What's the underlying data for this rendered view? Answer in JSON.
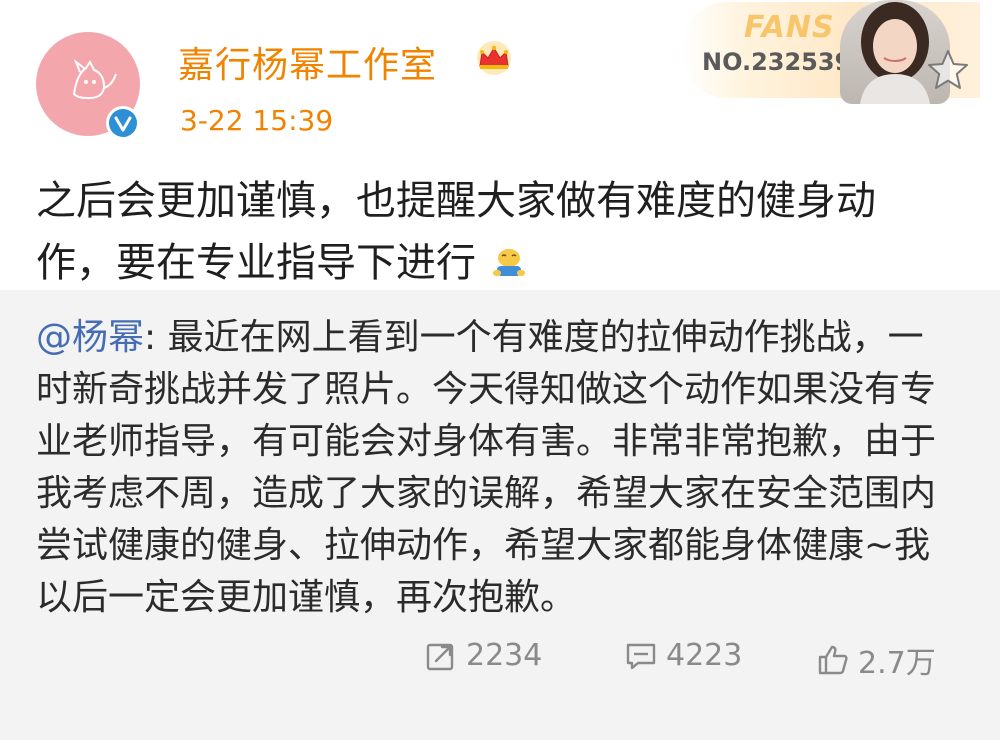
{
  "header": {
    "username": "嘉行杨幂工作室",
    "timestamp": "3-22 15:39",
    "fans_label": "FANS",
    "fans_number": "NO.232539"
  },
  "post": {
    "text": "之后会更加谨慎，也提醒大家做有难度的健身动作，要在专业指导下进行"
  },
  "repost": {
    "mention": "@杨幂",
    "text": ": 最近在网上看到一个有难度的拉伸动作挑战，一时新奇挑战并发了照片。今天得知做这个动作如果没有专业老师指导，有可能会对身体有害。非常非常抱歉，由于我考虑不周，造成了大家的误解，希望大家在安全范围内尝试健康的健身、拉伸动作，希望大家都能身体健康~我以后一定会更加谨慎，再次抱歉。"
  },
  "actions": {
    "repost_count": "2234",
    "comment_count": "4223",
    "like_count": "2.7万"
  },
  "colors": {
    "username": "#f08300",
    "mention": "#466db4",
    "verified": "#2d8fd5"
  }
}
